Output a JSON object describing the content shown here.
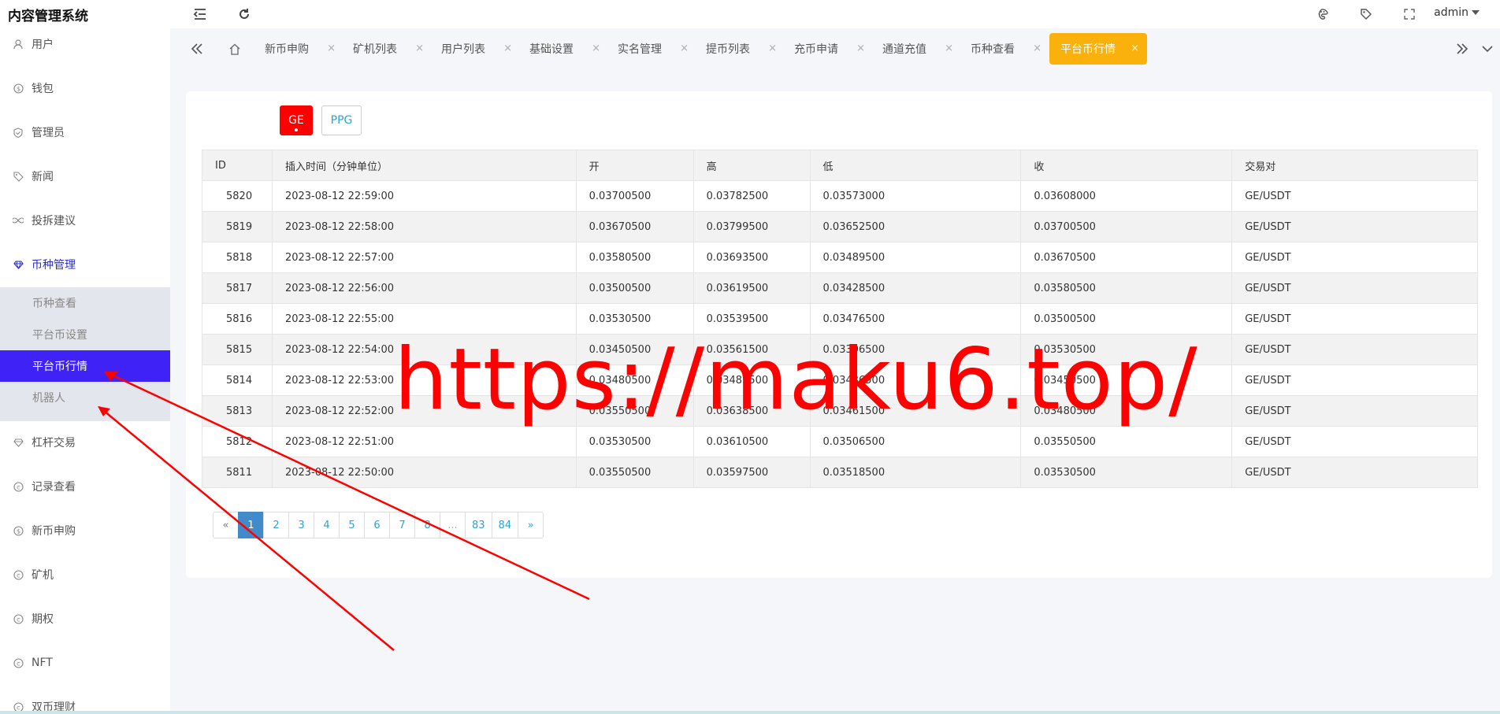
{
  "app": {
    "title": "内容管理系统",
    "user": "admin"
  },
  "sidebar": {
    "items": [
      {
        "label": "用户",
        "icon": "user-icon"
      },
      {
        "label": "钱包",
        "icon": "dollar-icon"
      },
      {
        "label": "管理员",
        "icon": "shield-icon"
      },
      {
        "label": "新闻",
        "icon": "tag-icon"
      },
      {
        "label": "投拆建议",
        "icon": "infinity-icon"
      },
      {
        "label": "币种管理",
        "icon": "diamond-icon"
      },
      {
        "label": "杠杆交易",
        "icon": "diamond-icon"
      },
      {
        "label": "记录查看",
        "icon": "circle-icon"
      },
      {
        "label": "新币申购",
        "icon": "dollar-icon"
      },
      {
        "label": "矿机",
        "icon": "circle-icon"
      },
      {
        "label": "期权",
        "icon": "circle-icon"
      },
      {
        "label": "NFT",
        "icon": "circle-icon"
      },
      {
        "label": "双币理财",
        "icon": "circle-icon"
      }
    ],
    "submenu": [
      {
        "label": "币种查看"
      },
      {
        "label": "平台币设置"
      },
      {
        "label": "平台币行情"
      },
      {
        "label": "机器人"
      }
    ]
  },
  "tabs": [
    {
      "label": "新币申购"
    },
    {
      "label": "矿机列表"
    },
    {
      "label": "用户列表"
    },
    {
      "label": "基础设置"
    },
    {
      "label": "实名管理"
    },
    {
      "label": "提币列表"
    },
    {
      "label": "充币申请"
    },
    {
      "label": "通道充值"
    },
    {
      "label": "币种查看"
    },
    {
      "label": "平台币行情"
    }
  ],
  "coins": [
    {
      "label": "GE"
    },
    {
      "label": "PPG"
    }
  ],
  "table": {
    "columns": [
      "ID",
      "插入时间（分钟单位）",
      "开",
      "高",
      "低",
      "收",
      "交易对"
    ],
    "rows": [
      [
        "5820",
        "2023-08-12 22:59:00",
        "0.03700500",
        "0.03782500",
        "0.03573000",
        "0.03608000",
        "GE/USDT"
      ],
      [
        "5819",
        "2023-08-12 22:58:00",
        "0.03670500",
        "0.03799500",
        "0.03652500",
        "0.03700500",
        "GE/USDT"
      ],
      [
        "5818",
        "2023-08-12 22:57:00",
        "0.03580500",
        "0.03693500",
        "0.03489500",
        "0.03670500",
        "GE/USDT"
      ],
      [
        "5817",
        "2023-08-12 22:56:00",
        "0.03500500",
        "0.03619500",
        "0.03428500",
        "0.03580500",
        "GE/USDT"
      ],
      [
        "5816",
        "2023-08-12 22:55:00",
        "0.03530500",
        "0.03539500",
        "0.03476500",
        "0.03500500",
        "GE/USDT"
      ],
      [
        "5815",
        "2023-08-12 22:54:00",
        "0.03450500",
        "0.03561500",
        "0.03396500",
        "0.03530500",
        "GE/USDT"
      ],
      [
        "5814",
        "2023-08-12 22:53:00",
        "0.03480500",
        "0.03483500",
        "0.03436500",
        "0.03450500",
        "GE/USDT"
      ],
      [
        "5813",
        "2023-08-12 22:52:00",
        "0.03550500",
        "0.03638500",
        "0.03461500",
        "0.03480500",
        "GE/USDT"
      ],
      [
        "5812",
        "2023-08-12 22:51:00",
        "0.03530500",
        "0.03610500",
        "0.03506500",
        "0.03550500",
        "GE/USDT"
      ],
      [
        "5811",
        "2023-08-12 22:50:00",
        "0.03550500",
        "0.03597500",
        "0.03518500",
        "0.03530500",
        "GE/USDT"
      ]
    ]
  },
  "pagination": [
    "«",
    "1",
    "2",
    "3",
    "4",
    "5",
    "6",
    "7",
    "8",
    "...",
    "83",
    "84",
    "»"
  ],
  "watermark": "https://maku6.top/",
  "colors": {
    "accent": "#3f22f5",
    "active_tab": "#fbb10c",
    "coin_active": "#ff0000",
    "annotation": "#ff0000"
  }
}
